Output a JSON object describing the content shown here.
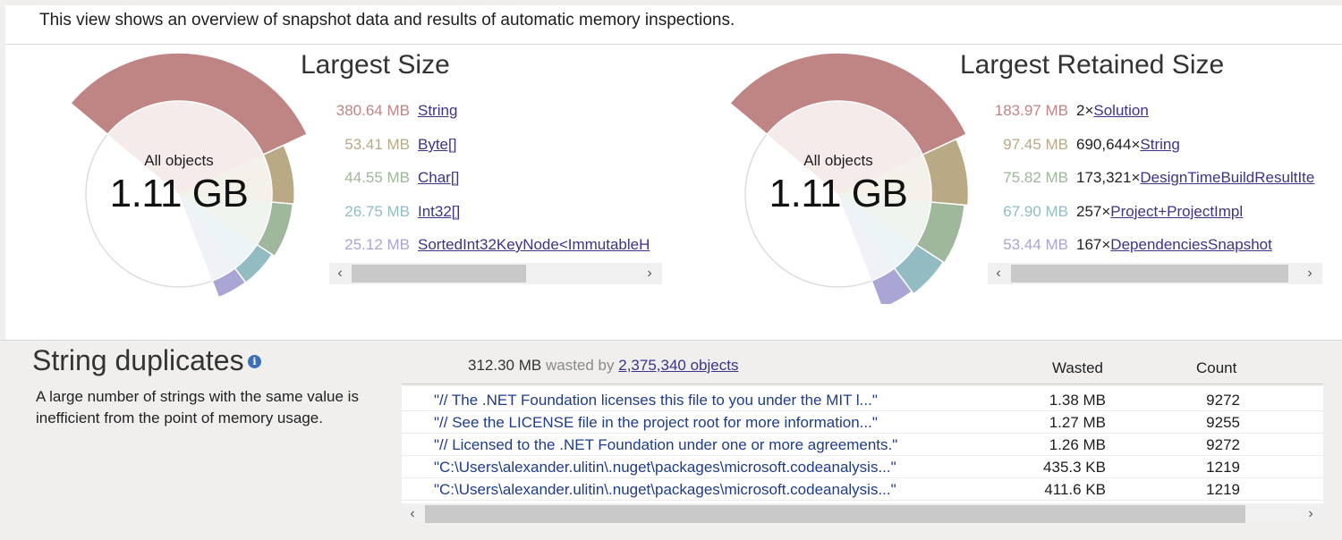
{
  "intro": "This view shows an overview of snapshot data and results of automatic memory inspections.",
  "largest_size": {
    "title": "Largest Size",
    "center_label": "All objects",
    "center_value": "1.11 GB",
    "items": [
      {
        "size": "380.64 MB",
        "name": "String",
        "color": "#bf8585"
      },
      {
        "size": "53.41 MB",
        "name": "Byte[]",
        "color": "#b9aa85"
      },
      {
        "size": "44.55 MB",
        "name": "Char[]",
        "color": "#9fb89c"
      },
      {
        "size": "26.75 MB",
        "name": "Int32[]",
        "color": "#92bcc2"
      },
      {
        "size": "25.12 MB",
        "name": "SortedInt32KeyNode<ImmutableH",
        "color": "#a9a5d4"
      }
    ]
  },
  "largest_retained": {
    "title": "Largest Retained Size",
    "center_label": "All objects",
    "center_value": "1.11 GB",
    "items": [
      {
        "size": "183.97 MB",
        "count": "2×",
        "name": "Solution",
        "color": "#bf8585"
      },
      {
        "size": "97.45 MB",
        "count": "690,644×",
        "name": "String",
        "color": "#b9aa85"
      },
      {
        "size": "75.82 MB",
        "count": "173,321×",
        "name": "DesignTimeBuildResultIte",
        "color": "#9fb89c"
      },
      {
        "size": "67.90 MB",
        "count": "257×",
        "name": "Project+ProjectImpl",
        "color": "#92bcc2"
      },
      {
        "size": "53.44 MB",
        "count": "167×",
        "name": "DependenciesSnapshot",
        "color": "#a9a5d4"
      }
    ]
  },
  "duplicates": {
    "title": "String duplicates",
    "description": "A large number of strings with the same value is inefficient from the point of memory usage.",
    "summary_size": "312.30 MB",
    "summary_mid": "wasted by",
    "summary_link": "2,375,340 objects",
    "col_wasted": "Wasted",
    "col_count": "Count",
    "rows": [
      {
        "value": "\"// The .NET Foundation licenses this file to you under the MIT l...\"",
        "wasted": "1.38 MB",
        "count": "9272"
      },
      {
        "value": "\"// See the LICENSE file in the project root for more information...\"",
        "wasted": "1.27 MB",
        "count": "9255"
      },
      {
        "value": "\"// Licensed to the .NET Foundation under one or more agreements.\"",
        "wasted": "1.26 MB",
        "count": "9272"
      },
      {
        "value": "\"C:\\Users\\alexander.ulitin\\.nuget\\packages\\microsoft.codeanalysis...\"",
        "wasted": "435.3 KB",
        "count": "1219"
      },
      {
        "value": "\"C:\\Users\\alexander.ulitin\\.nuget\\packages\\microsoft.codeanalysis...\"",
        "wasted": "411.6 KB",
        "count": "1219"
      }
    ]
  },
  "icons": {
    "scroll_left": "‹",
    "scroll_right": "›",
    "info": "i"
  }
}
